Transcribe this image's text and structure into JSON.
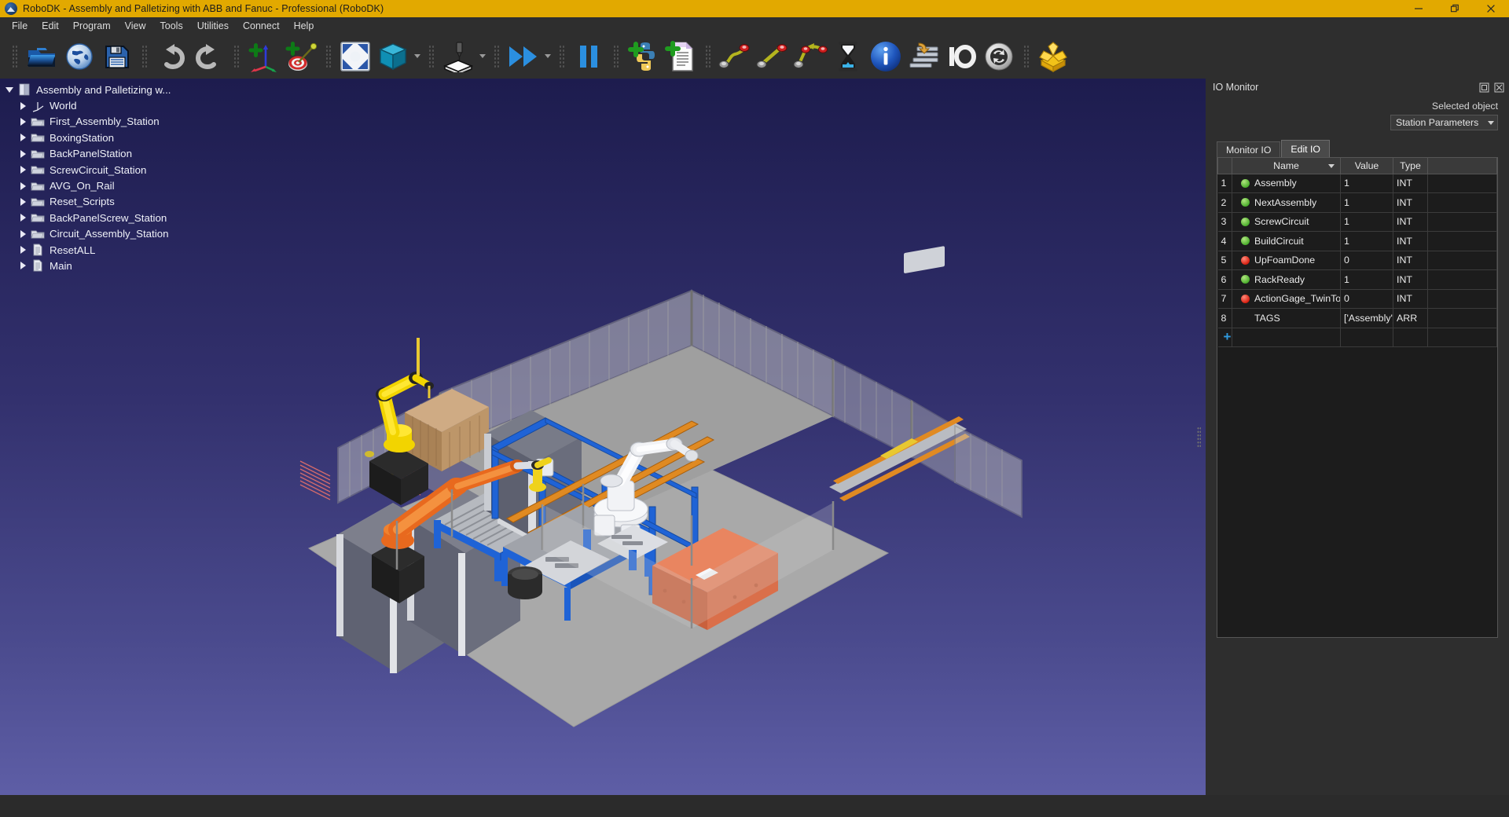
{
  "window": {
    "title": "RoboDK - Assembly and Palletizing with ABB and Fanuc - Professional (RoboDK)",
    "logo_icon": "robodk-logo-icon",
    "minimize_label": "Minimize",
    "maximize_label": "Maximize",
    "close_label": "Close",
    "titlebar_color": "#e2a900"
  },
  "menubar": {
    "items": [
      {
        "label": "File"
      },
      {
        "label": "Edit"
      },
      {
        "label": "Program"
      },
      {
        "label": "View"
      },
      {
        "label": "Tools"
      },
      {
        "label": "Utilities"
      },
      {
        "label": "Connect"
      },
      {
        "label": "Help"
      }
    ]
  },
  "toolbar": {
    "groups": [
      {
        "tools": [
          {
            "icon": "open-folder-icon",
            "label": "Open"
          },
          {
            "icon": "globe-icon",
            "label": "Open online library"
          },
          {
            "icon": "save-floppy-icon",
            "label": "Save"
          }
        ]
      },
      {
        "tools": [
          {
            "icon": "undo-arrow-icon",
            "label": "Undo"
          },
          {
            "icon": "redo-arrow-icon",
            "label": "Redo"
          }
        ]
      },
      {
        "tools": [
          {
            "icon": "add-reference-frame-icon",
            "label": "Add reference frame"
          },
          {
            "icon": "add-target-icon",
            "label": "Add target"
          }
        ]
      },
      {
        "tools": [
          {
            "icon": "fit-to-screen-icon",
            "label": "Fit all objects in view"
          },
          {
            "icon": "isometric-cube-icon",
            "label": "View mode",
            "has_dropdown": true
          }
        ]
      },
      {
        "tools": [
          {
            "icon": "tool-on-object-icon",
            "label": "Attach tool",
            "has_dropdown": true
          },
          {
            "icon": "run-fast-forward-icon",
            "label": "Run program",
            "has_dropdown": true
          },
          {
            "icon": "pause-icon",
            "label": "Pause"
          }
        ]
      },
      {
        "tools": [
          {
            "icon": "add-python-program-icon",
            "label": "Add Python program"
          },
          {
            "icon": "add-program-icon",
            "label": "Add program"
          }
        ]
      },
      {
        "tools": [
          {
            "icon": "move-joint-icon",
            "label": "Add joint move"
          },
          {
            "icon": "move-linear-icon",
            "label": "Add linear move"
          },
          {
            "icon": "move-circular-icon",
            "label": "Add circular move"
          },
          {
            "icon": "wait-hourglass-icon",
            "label": "Add pause instruction"
          },
          {
            "icon": "info-icon",
            "label": "Show information"
          },
          {
            "icon": "set-variable-icon",
            "label": "Set variable"
          },
          {
            "icon": "io-text-icon",
            "label": "Set digital output"
          },
          {
            "icon": "sync-circular-icon",
            "label": "Synchronize"
          }
        ]
      },
      {
        "tools": [
          {
            "icon": "open-package-box-icon",
            "label": "Package"
          }
        ]
      }
    ]
  },
  "tree": {
    "items": [
      {
        "label": "Assembly and Palletizing w...",
        "icon": "station-icon",
        "level": 1,
        "expanded": true
      },
      {
        "label": "World",
        "icon": "frame-axes-icon",
        "level": 2,
        "expanded": false
      },
      {
        "label": "First_Assembly_Station",
        "icon": "folder-icon",
        "level": 2,
        "expanded": false
      },
      {
        "label": "BoxingStation",
        "icon": "folder-icon",
        "level": 2,
        "expanded": false
      },
      {
        "label": "BackPanelStation",
        "icon": "folder-icon",
        "level": 2,
        "expanded": false
      },
      {
        "label": "ScrewCircuit_Station",
        "icon": "folder-icon",
        "level": 2,
        "expanded": false
      },
      {
        "label": "AVG_On_Rail",
        "icon": "folder-icon",
        "level": 2,
        "expanded": false
      },
      {
        "label": "Reset_Scripts",
        "icon": "folder-icon",
        "level": 2,
        "expanded": false
      },
      {
        "label": "BackPanelScrew_Station",
        "icon": "folder-icon",
        "level": 2,
        "expanded": false
      },
      {
        "label": "Circuit_Assembly_Station",
        "icon": "folder-icon",
        "level": 2,
        "expanded": false
      },
      {
        "label": "ResetALL",
        "icon": "program-document-icon",
        "level": 2,
        "expanded": false
      },
      {
        "label": "Main",
        "icon": "program-document-icon",
        "level": 2,
        "expanded": false
      }
    ]
  },
  "io_panel": {
    "title": "IO Monitor",
    "float_icon": "undock-icon",
    "close_icon": "close-panel-icon",
    "selected_object_label": "Selected object",
    "selected_object_value": "Station Parameters",
    "tabs": [
      {
        "label": "Monitor IO",
        "active": false
      },
      {
        "label": "Edit IO",
        "active": true
      }
    ],
    "columns": [
      "Name",
      "Value",
      "Type"
    ],
    "rows": [
      {
        "index": "1",
        "led": "on",
        "name": "Assembly",
        "value": "1",
        "type": "INT"
      },
      {
        "index": "2",
        "led": "on",
        "name": "NextAssembly",
        "value": "1",
        "type": "INT"
      },
      {
        "index": "3",
        "led": "on",
        "name": "ScrewCircuit",
        "value": "1",
        "type": "INT"
      },
      {
        "index": "4",
        "led": "on",
        "name": "BuildCircuit",
        "value": "1",
        "type": "INT"
      },
      {
        "index": "5",
        "led": "off",
        "name": "UpFoamDone",
        "value": "0",
        "type": "INT"
      },
      {
        "index": "6",
        "led": "on",
        "name": "RackReady",
        "value": "1",
        "type": "INT"
      },
      {
        "index": "7",
        "led": "off",
        "name": "ActionGage_TwinTool",
        "value": "0",
        "type": "INT"
      },
      {
        "index": "8",
        "led": "none",
        "name": "TAGS",
        "value": "['Assembly']",
        "type": "ARR"
      }
    ],
    "add_row_label": "+"
  },
  "viewport": {
    "background_top_color": "#1d1c4e",
    "background_bottom_color": "#5e5ea6",
    "floor_color": "#a8a8a8",
    "scene_name": "assembly-and-palletizing-cell-3d-view"
  },
  "statusbar": {
    "text": ""
  }
}
